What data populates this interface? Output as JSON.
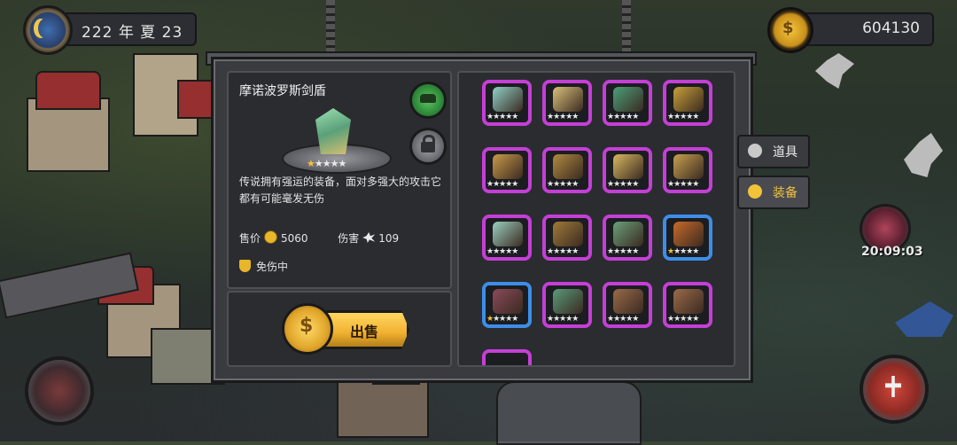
{
  "top": {
    "date": "222 年 夏 23",
    "gold": "604130"
  },
  "item": {
    "name": "摩诺波罗斯剑盾",
    "stars_lit": 1,
    "stars_total": 5,
    "description": "传说拥有强运的装备，面对多强大的攻击它都有可能毫发无伤",
    "price_label": "售价",
    "price": "5060",
    "damage_label": "伤害",
    "damage": "109",
    "status": "免伤中"
  },
  "sell": {
    "label": "出售"
  },
  "tabs": {
    "items": "道具",
    "equipment": "装备"
  },
  "boss": {
    "timer": "20:09:03"
  },
  "inventory": [
    {
      "rarity": "purple",
      "stars": 4,
      "color": "#8fd0c8"
    },
    {
      "rarity": "purple",
      "stars": 4,
      "color": "#d9c07a"
    },
    {
      "rarity": "purple",
      "stars": 4,
      "color": "#4aa07a"
    },
    {
      "rarity": "purple",
      "stars": 4,
      "color": "#c8a03a"
    },
    {
      "rarity": "purple",
      "stars": 4,
      "color": "#c89a4a"
    },
    {
      "rarity": "purple",
      "stars": 4,
      "color": "#b08a40"
    },
    {
      "rarity": "purple",
      "stars": 4,
      "color": "#d8b860"
    },
    {
      "rarity": "purple",
      "stars": 4,
      "color": "#c8a050"
    },
    {
      "rarity": "purple",
      "stars": 4,
      "color": "#9ad0c0"
    },
    {
      "rarity": "purple",
      "stars": 4,
      "color": "#a07a3a"
    },
    {
      "rarity": "purple",
      "stars": 4,
      "color": "#6aa07a"
    },
    {
      "rarity": "blue",
      "stars": 4,
      "color": "#c86a2a"
    },
    {
      "rarity": "blue",
      "stars": 3,
      "color": "#8a4a5a"
    },
    {
      "rarity": "purple",
      "stars": 3,
      "color": "#5a9a7a"
    },
    {
      "rarity": "purple",
      "stars": 3,
      "color": "#9a6a4a"
    },
    {
      "rarity": "purple",
      "stars": 3,
      "color": "#9a6a4a"
    }
  ]
}
